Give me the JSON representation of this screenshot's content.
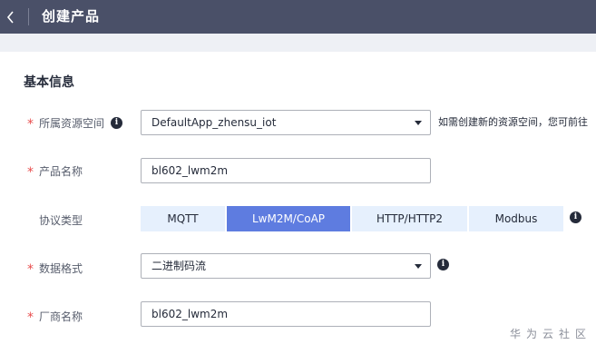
{
  "header": {
    "title": "创建产品",
    "back_icon": "chevron-left-icon"
  },
  "section": {
    "title": "基本信息"
  },
  "form": {
    "required_mark": "*",
    "resource_space": {
      "label": "所属资源空间",
      "value": "DefaultApp_zhensu_iot",
      "hint": "如需创建新的资源空间，您可前往"
    },
    "product_name": {
      "label": "产品名称",
      "value": "bl602_lwm2m"
    },
    "protocol": {
      "label": "协议类型",
      "options": [
        "MQTT",
        "LwM2M/CoAP",
        "HTTP/HTTP2",
        "Modbus"
      ],
      "selected": "LwM2M/CoAP"
    },
    "data_format": {
      "label": "数据格式",
      "value": "二进制码流"
    },
    "manufacturer": {
      "label": "厂商名称",
      "value": "bl602_lwm2m"
    },
    "info_icon_glyph": "i"
  },
  "watermark": "华为云社区",
  "colors": {
    "header_bg": "#4a5068",
    "accent": "#5e7ce0",
    "required": "#e84d4d",
    "segment_bg": "#e6f0fd"
  }
}
